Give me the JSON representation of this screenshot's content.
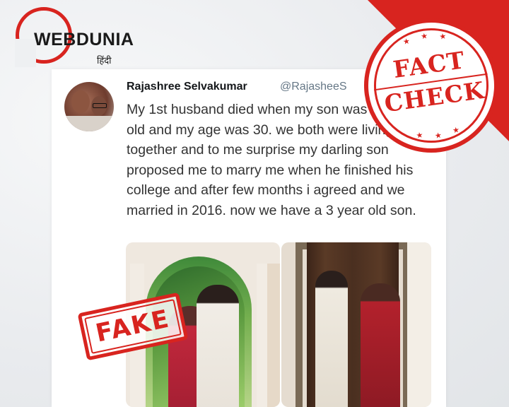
{
  "logo": {
    "word": "WEBDUNIA",
    "subtitle": "हिंदी"
  },
  "tweet": {
    "name": "Rajashree Selvakumar",
    "handle": "@RajasheeS",
    "text": "My 1st husband died when my son was 12 years old and my age was 30. we both were living together and to me surprise my darling son proposed me to marry me when he finished his college and after few months i agreed and we married in 2016. now we have a 3 year old son."
  },
  "stamps": {
    "fact_line1": "FACT",
    "fact_line2": "CHECK",
    "fake": "FAKE"
  },
  "colors": {
    "accent_red": "#d8241f",
    "card_bg": "#ffffff"
  }
}
